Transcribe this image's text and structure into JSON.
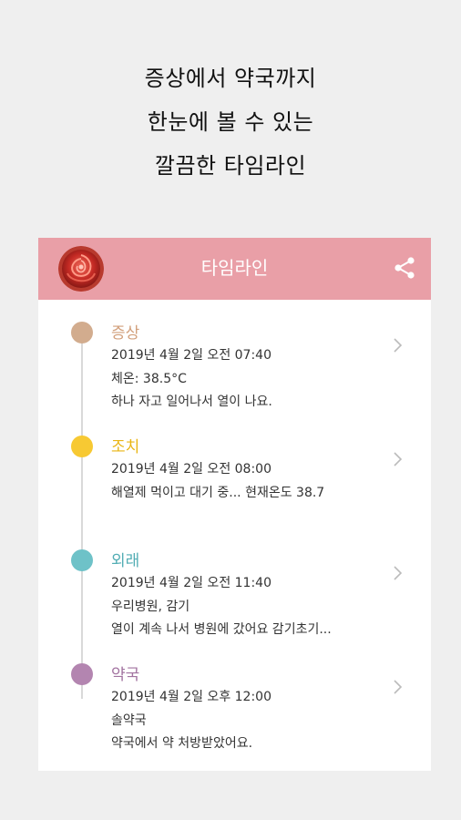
{
  "headline": {
    "line1": "증상에서 약국까지",
    "line2": "한눈에 볼 수 있는",
    "line3": "깔끔한 타임라인"
  },
  "appbar": {
    "title": "타임라인",
    "share_icon": "share-icon",
    "avatar": "rose-avatar"
  },
  "colors": {
    "appbar": "#e99fa7",
    "symptom": "#d2ac8e",
    "action": "#f7c933",
    "visit": "#6ec2c8",
    "pharmacy": "#b385b0"
  },
  "entries": [
    {
      "title": "증상",
      "datetime": "2019년 4월 2일 오전 07:40",
      "detail1": "체온: 38.5°C",
      "detail2": "하나 자고 일어나서 열이 나요."
    },
    {
      "title": "조치",
      "datetime": "2019년 4월 2일 오전 08:00",
      "detail1": "해열제 먹이고 대기 중... 현재온도 38.7",
      "detail2": ""
    },
    {
      "title": "외래",
      "datetime": "2019년 4월 2일 오전 11:40",
      "detail1": "우리병원, 감기",
      "detail2": "열이 계속 나서 병원에 갔어요 감기초기..."
    },
    {
      "title": "약국",
      "datetime": "2019년 4월 2일 오후 12:00",
      "detail1": "솔약국",
      "detail2": "약국에서 약 처방받았어요."
    }
  ]
}
